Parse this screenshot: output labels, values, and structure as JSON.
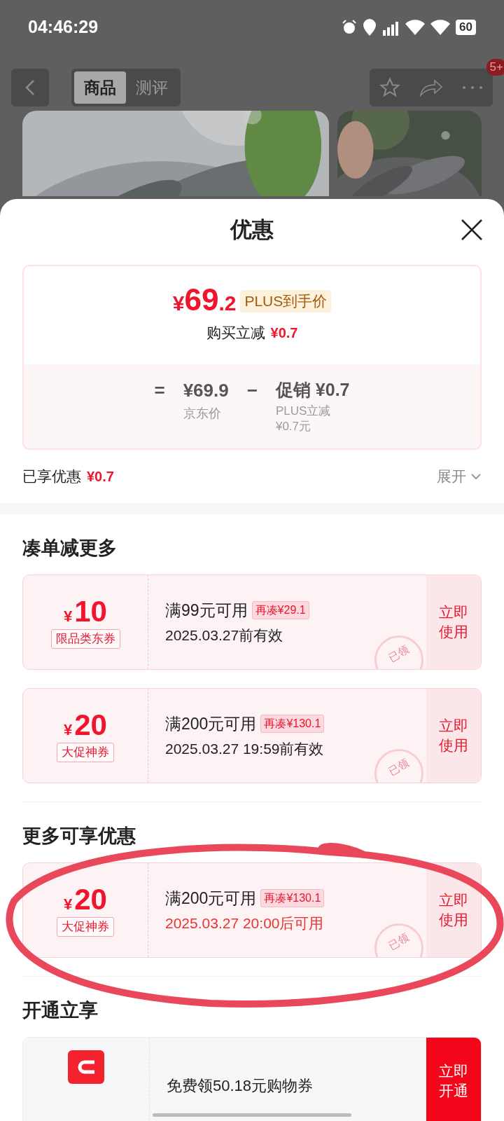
{
  "status_bar": {
    "time": "04:46:29",
    "battery": "60"
  },
  "nav": {
    "tabs": [
      {
        "label": "商品",
        "selected": true
      },
      {
        "label": "测评",
        "selected": false
      }
    ],
    "badge": "5+"
  },
  "sheet": {
    "title": "优惠",
    "price_card": {
      "currency": "¥",
      "integer": "69",
      "decimal": ".2",
      "tag": "PLUS到手价",
      "reduction_label": "购买立减",
      "reduction_amount": "¥0.7",
      "equals": "=",
      "base_amount": "¥69.9",
      "base_label": "京东价",
      "minus": "−",
      "promo_amount": "促销 ¥0.7",
      "promo_label": "PLUS立减",
      "promo_detail": "¥0.7元"
    },
    "enjoyed": {
      "label": "已享优惠",
      "amount": "¥0.7",
      "expand": "展开"
    },
    "sections": [
      {
        "title": "凑单减更多",
        "coupons": [
          {
            "kind": "coupon",
            "currency": "¥",
            "amount": "10",
            "type": "限品类东券",
            "condition": "满99元可用",
            "gap": "再凑¥29.1",
            "validity": "2025.03.27前有效",
            "validity_highlight": false,
            "action": "立即使用",
            "stamp": "已领"
          },
          {
            "kind": "coupon",
            "currency": "¥",
            "amount": "20",
            "type": "大促神券",
            "condition": "满200元可用",
            "gap": "再凑¥130.1",
            "validity": "2025.03.27 19:59前有效",
            "validity_highlight": false,
            "action": "立即使用",
            "stamp": "已领"
          }
        ]
      },
      {
        "title": "更多可享优惠",
        "coupons": [
          {
            "kind": "coupon",
            "currency": "¥",
            "amount": "20",
            "type": "大促神券",
            "condition": "满200元可用",
            "gap": "再凑¥130.1",
            "validity": "2025.03.27 20:00后可用",
            "validity_highlight": true,
            "action": "立即使用",
            "stamp": "已领"
          }
        ]
      },
      {
        "title": "开通立享",
        "coupons": [
          {
            "kind": "membership",
            "condition": "免费领50.18元购物券",
            "action": "立即开通"
          }
        ]
      }
    ]
  }
}
